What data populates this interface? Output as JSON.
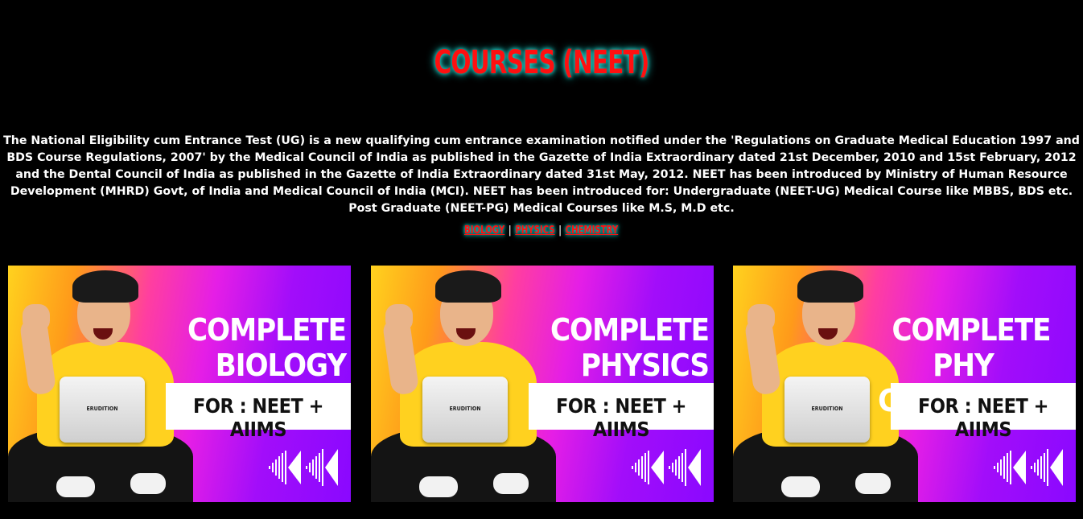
{
  "page": {
    "title": "COURSES (NEET)",
    "intro": "The National Eligibility cum Entrance Test (UG) is a new qualifying cum entrance examination notified under the 'Regulations on Graduate Medical Education 1997 and BDS Course Regulations, 2007' by the Medical Council of India as published in the Gazette of India Extraordinary dated 21st December, 2010 and 15st February, 2012 and the Dental Council of India as published in the Gazette of India Extraordinary dated 31st May, 2012. NEET has been introduced by Ministry of Human Resource Development (MHRD) Govt, of India and Medical Council of India (MCI). NEET has been introduced for: Undergraduate (NEET-UG) Medical Course like MBBS, BDS etc. Post Graduate (NEET-PG) Medical Courses like M.S, M.D etc."
  },
  "subnav": {
    "separator": "|",
    "links": [
      "BIOLOGY",
      "PHYSICS",
      "CHEMISTRY"
    ]
  },
  "cards": [
    {
      "line1": "COMPLETE",
      "line2": "BIOLOGY",
      "banner": "FOR : NEET + AIIMS",
      "laptop_text": "ERUDITION"
    },
    {
      "line1": "COMPLETE",
      "line2": "PHYSICS",
      "banner": "FOR : NEET + AIIMS",
      "laptop_text": "ERUDITION"
    },
    {
      "line1": "COMPLETE",
      "line2": "PHY CHEMISTRY",
      "banner": "FOR : NEET + AIIMS",
      "laptop_text": "ERUDITION"
    }
  ],
  "colors": {
    "title": "#ff1010",
    "glow": "#1fe0d8",
    "background": "#000000",
    "card_gradient_start": "#ffd21e",
    "card_gradient_end": "#8a08ff"
  },
  "icons": [
    "rewind-icon"
  ]
}
